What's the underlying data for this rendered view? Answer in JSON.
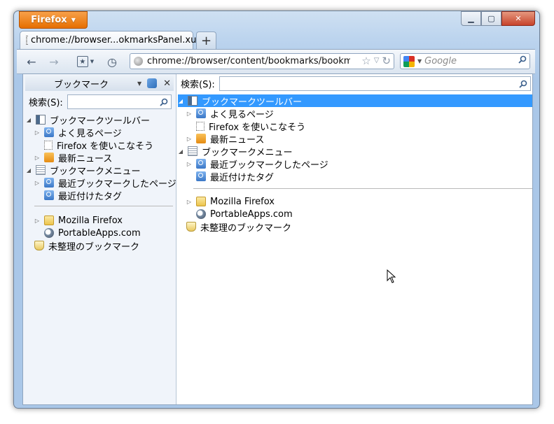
{
  "window": {
    "app_button": "Firefox",
    "controls": [
      "minimize",
      "maximize",
      "close"
    ]
  },
  "tabs": [
    {
      "label": "chrome://browser...okmarksPanel.xul"
    }
  ],
  "toolbar": {
    "url": "chrome://browser/content/bookmarks/bookmarksPanel.xul",
    "search_placeholder": "Google"
  },
  "sidebar": {
    "title": "ブックマーク",
    "search_label": "検索(S):",
    "tree": [
      {
        "label": "ブックマークツールバー",
        "icon": "bookmarks-toolbar-icon",
        "twisty": "open",
        "level": 0
      },
      {
        "label": "よく見るページ",
        "icon": "smart-folder-icon",
        "twisty": "closed",
        "level": 1
      },
      {
        "label": "Firefox を使いこなそう",
        "icon": "page-icon",
        "twisty": "none",
        "level": 1
      },
      {
        "label": "最新ニュース",
        "icon": "rss-icon",
        "twisty": "closed",
        "level": 1
      },
      {
        "label": "ブックマークメニュー",
        "icon": "bookmarks-menu-icon",
        "twisty": "open",
        "level": 0
      },
      {
        "label": "最近ブックマークしたページ",
        "icon": "smart-folder-icon",
        "twisty": "closed",
        "level": 1
      },
      {
        "label": "最近付けたタグ",
        "icon": "smart-folder-icon",
        "twisty": "none",
        "level": 1
      },
      {
        "label": "Mozilla Firefox",
        "icon": "folder-icon",
        "twisty": "closed",
        "level": 1
      },
      {
        "label": "PortableApps.com",
        "icon": "portableapps-icon",
        "twisty": "none",
        "level": 1
      },
      {
        "label": "未整理のブックマーク",
        "icon": "unsorted-bookmarks-icon",
        "twisty": "none",
        "level": 0
      }
    ]
  },
  "main": {
    "search_label": "検索(S):",
    "tree": [
      {
        "label": "ブックマークツールバー",
        "selected": true
      },
      {
        "label": "よく見るページ"
      },
      {
        "label": "Firefox を使いこなそう"
      },
      {
        "label": "最新ニュース"
      },
      {
        "label": "ブックマークメニュー"
      },
      {
        "label": "最近ブックマークしたページ"
      },
      {
        "label": "最近付けたタグ"
      },
      {
        "label": "Mozilla Firefox"
      },
      {
        "label": "PortableApps.com"
      },
      {
        "label": "未整理のブックマーク"
      }
    ]
  }
}
